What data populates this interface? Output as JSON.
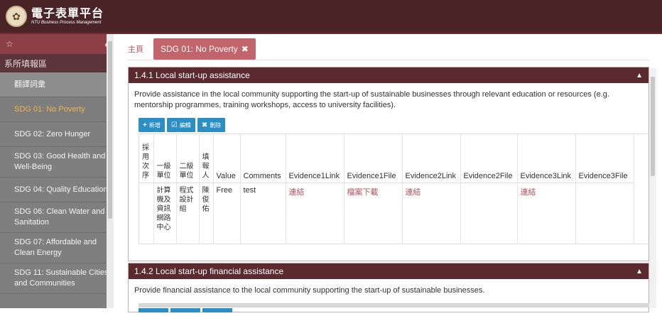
{
  "header": {
    "title": "電子表單平台",
    "subtitle": "NTU Business Process Management"
  },
  "sidebar": {
    "star_icon": "star-icon",
    "collapse_icon": "chevron-left-icon",
    "section": "系所填報區",
    "items": [
      {
        "label": "翻譯詞彙"
      },
      {
        "label": "SDG 01: No Poverty"
      },
      {
        "label": "SDG 02: Zero Hunger"
      },
      {
        "label": "SDG 03: Good Health and Well-Being"
      },
      {
        "label": "SDG 04: Quality Education"
      },
      {
        "label": "SDG 06: Clean Water and Sanitation"
      },
      {
        "label": "SDG 07: Affordable and Clean Energy"
      },
      {
        "label": "SDG 11: Sustainable Cities and Communities"
      }
    ]
  },
  "tabs": {
    "home": "主頁",
    "active": "SDG 01: No Poverty",
    "close_icon": "close-icon"
  },
  "panel1": {
    "title": "1.4.1 Local start-up assistance",
    "description": "Provide assistance in the local community supporting the start-up of sustainable businesses through relevant education or resources (e.g. mentorship programmes, training workshops, access to university facilities).",
    "toolbar": {
      "add": "新增",
      "edit": "編輯",
      "delete": "刪除"
    },
    "columns": [
      "採用次序",
      "一級單位",
      "二級單位",
      "填報人",
      "Value",
      "Comments",
      "Evidence1Link",
      "Evidence1File",
      "Evidence2Link",
      "Evidence2File",
      "Evidence3Link",
      "Evidence3File"
    ],
    "rows": [
      [
        "",
        "計算機及資訊網路中心",
        "程式設計組",
        "陳俊佑",
        "Free",
        "test",
        "連結",
        "檔案下載",
        "連結",
        "",
        "連結",
        ""
      ]
    ]
  },
  "panel2": {
    "title": "1.4.2 Local start-up financial assistance",
    "description": "Provide financial assistance to the local community supporting the start-up of sustainable businesses."
  },
  "colors": {
    "topbar": "#4a2327",
    "panel_header": "#5a2a2f",
    "tab_active": "#c2646b",
    "button": "#2b8ec4",
    "active_item": "#f0b54b"
  }
}
